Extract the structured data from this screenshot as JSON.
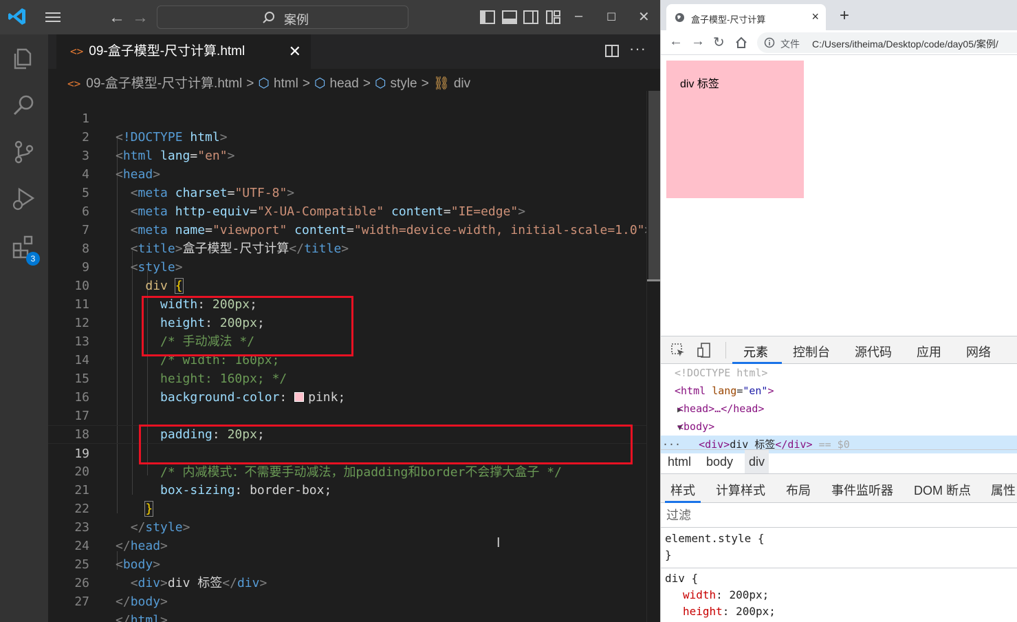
{
  "vscode": {
    "search_text": "案例",
    "tab_title": "09-盒子模型-尺寸计算.html",
    "breadcrumb": [
      "09-盒子模型-尺寸计算.html",
      "html",
      "head",
      "style",
      "div"
    ],
    "extensions_badge": "3",
    "line_numbers": [
      "1",
      "2",
      "3",
      "4",
      "5",
      "6",
      "7",
      "8",
      "9",
      "10",
      "11",
      "12",
      "13",
      "14",
      "15",
      "16",
      "17",
      "18",
      "19",
      "20",
      "21",
      "22",
      "23",
      "24",
      "25",
      "26",
      "27"
    ],
    "active_line": "19",
    "code": {
      "l1": {
        "a": "<",
        "b": "!DOCTYPE",
        "c": " html",
        "d": ">"
      },
      "l2": {
        "tag": "html",
        "attr": "lang",
        "val": "\"en\""
      },
      "l3": {
        "tag": "head"
      },
      "l4": {
        "tag": "meta",
        "attr": "charset",
        "val": "\"UTF-8\""
      },
      "l5": {
        "tag": "meta",
        "attr1": "http-equiv",
        "val1": "\"X-UA-Compatible\"",
        "attr2": "content",
        "val2": "\"IE=edge\""
      },
      "l6": {
        "tag": "meta",
        "attr1": "name",
        "val1": "\"viewport\"",
        "attr2": "content",
        "val2": "\"width=device-width, initial-scale=1.0\""
      },
      "l7": {
        "tag": "title",
        "text": "盒子模型-尺寸计算"
      },
      "l8": {
        "tag": "style"
      },
      "l9": {
        "sel": "div",
        "brace": "{"
      },
      "l10": {
        "prop": "width",
        "num": "200px"
      },
      "l11": {
        "prop": "height",
        "num": "200px"
      },
      "l12": "/* 手动减法 */",
      "l13": "/* width: 160px;",
      "l14": "height: 160px; */",
      "l15": {
        "prop": "background-color",
        "val": "pink"
      },
      "l17": {
        "prop": "padding",
        "num": "20px"
      },
      "l19": "/* 内减模式：不需要手动减法，加padding和border不会撑大盒子 */",
      "l20": {
        "prop": "box-sizing",
        "val": "border-box"
      },
      "l21": "}",
      "l22": {
        "tag": "style"
      },
      "l23": {
        "tag": "head"
      },
      "l24": {
        "tag": "body"
      },
      "l25": {
        "tag": "div",
        "text": "div 标签"
      },
      "l26": {
        "tag": "body"
      },
      "l27": {
        "tag": "html"
      }
    }
  },
  "browser": {
    "tab_title": "盒子模型-尺寸计算",
    "address_label": "文件",
    "url": "C:/Users/itheima/Desktop/code/day05/案例/",
    "page_text": "div 标签",
    "box_color": "#ffc0cb",
    "devtools": {
      "tabs": [
        "元素",
        "控制台",
        "源代码",
        "应用",
        "网络"
      ],
      "active_tab": "元素",
      "dom": {
        "doctype": "<!DOCTYPE html>",
        "html_tag": "html",
        "html_attr": "lang",
        "html_val": "\"en\"",
        "head_collapsed": "<head>…</head>",
        "body_tag": "<body>",
        "div_open": "<div>",
        "div_text": "div 标签",
        "div_close": "</div>",
        "div_ref": "== $0"
      },
      "crumbs": [
        "html",
        "body",
        "div"
      ],
      "subtabs": [
        "样式",
        "计算样式",
        "布局",
        "事件监听器",
        "DOM 断点",
        "属性"
      ],
      "active_subtab": "样式",
      "filter_placeholder": "过滤",
      "styles": {
        "element_style": "element.style {",
        "close": "}",
        "div_rule": "div {",
        "width_prop": "width",
        "width_val": "200px;",
        "height_prop": "height",
        "height_val": "200px;"
      }
    }
  }
}
